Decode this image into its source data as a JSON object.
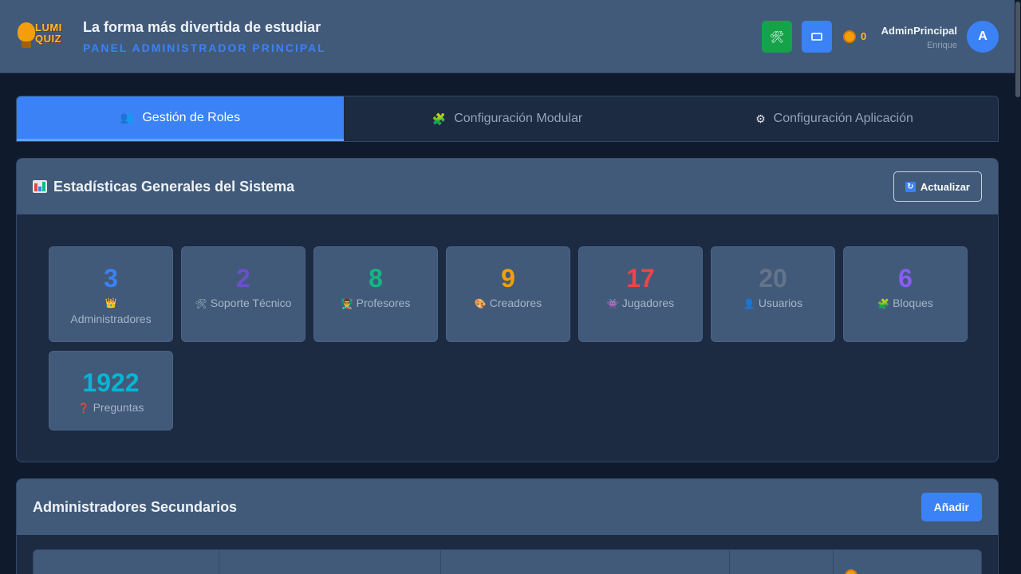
{
  "brand": {
    "logo_text_1": "LUMI",
    "logo_text_2": "QUIZ"
  },
  "header": {
    "slogan": "La forma más divertida de estudiar",
    "panel_label": "PANEL ADMINISTRADOR PRINCIPAL",
    "tools_icon": "tools-icon",
    "camera_icon": "camera-icon",
    "coins": "0",
    "user_name": "AdminPrincipal",
    "user_sub": "Enrique",
    "avatar_letter": "A"
  },
  "tabs": [
    {
      "label": "Gestión de Roles",
      "icon": "users-icon",
      "active": true
    },
    {
      "label": "Configuración Modular",
      "icon": "blocks-icon",
      "active": false
    },
    {
      "label": "Configuración Aplicación",
      "icon": "gear-icon",
      "active": false
    }
  ],
  "stats": {
    "title": "Estadísticas Generales del Sistema",
    "refresh_label": "Actualizar",
    "items": [
      {
        "value": "3",
        "label": "Administradores",
        "emoji": "👑",
        "color": "#3b82f6"
      },
      {
        "value": "2",
        "label": "Soporte Técnico",
        "emoji": "🛠",
        "color": "#6d4fc9"
      },
      {
        "value": "8",
        "label": "Profesores",
        "emoji": "👨‍🏫",
        "color": "#10b981"
      },
      {
        "value": "9",
        "label": "Creadores",
        "emoji": "🎨",
        "color": "#f59e0b"
      },
      {
        "value": "17",
        "label": "Jugadores",
        "emoji": "👾",
        "color": "#ef4444"
      },
      {
        "value": "20",
        "label": "Usuarios",
        "emoji": "👤",
        "color": "#64748b"
      },
      {
        "value": "6",
        "label": "Bloques",
        "emoji": "🧩",
        "color": "#8b5cf6"
      },
      {
        "value": "1922",
        "label": "Preguntas",
        "emoji": "❓",
        "color": "#06b6d4"
      }
    ]
  },
  "admins": {
    "title": "Administradores Secundarios",
    "add_label": "Añadir"
  }
}
